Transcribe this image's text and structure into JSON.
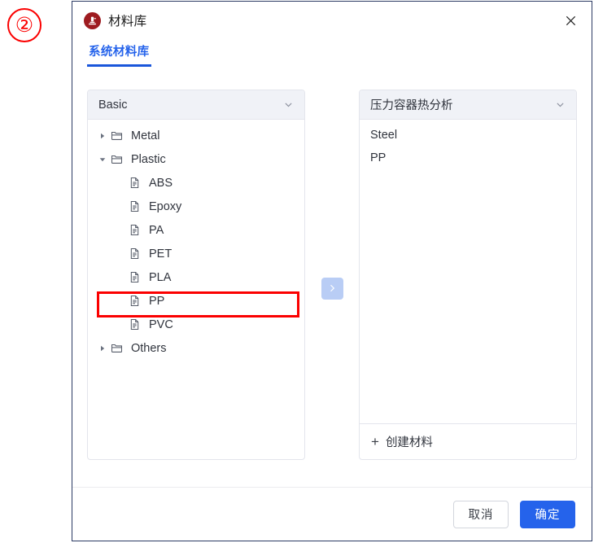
{
  "annotation": {
    "marker_label": "②",
    "marker_color": "#fb0000",
    "highlight_target": "PP"
  },
  "dialog": {
    "title": "材料库",
    "app_icon": "microscope-icon",
    "close_icon": "close-icon",
    "accent_color": "#2563eb"
  },
  "tabs": [
    {
      "label": "系统材料库",
      "active": true
    }
  ],
  "left_panel": {
    "header": {
      "label": "Basic",
      "chevron": "chevron-down-icon"
    },
    "tree": [
      {
        "label": "Metal",
        "type": "folder",
        "depth": 0,
        "expanded": false,
        "caret": "caret-right-icon"
      },
      {
        "label": "Plastic",
        "type": "folder",
        "depth": 0,
        "expanded": true,
        "caret": "caret-down-icon"
      },
      {
        "label": "ABS",
        "type": "document",
        "depth": 1,
        "caret": "none"
      },
      {
        "label": "Epoxy",
        "type": "document",
        "depth": 1,
        "caret": "none"
      },
      {
        "label": "PA",
        "type": "document",
        "depth": 1,
        "caret": "none"
      },
      {
        "label": "PET",
        "type": "document",
        "depth": 1,
        "caret": "none"
      },
      {
        "label": "PLA",
        "type": "document",
        "depth": 1,
        "caret": "none"
      },
      {
        "label": "PP",
        "type": "document",
        "depth": 1,
        "caret": "none",
        "highlighted": true
      },
      {
        "label": "PVC",
        "type": "document",
        "depth": 1,
        "caret": "none"
      },
      {
        "label": "Others",
        "type": "folder",
        "depth": 0,
        "expanded": false,
        "caret": "caret-right-icon"
      }
    ]
  },
  "transfer": {
    "icon": "chevron-right-icon",
    "color": "#b9cdf5"
  },
  "right_panel": {
    "header": {
      "label": "压力容器热分析",
      "chevron": "chevron-down-icon"
    },
    "materials": [
      {
        "label": "Steel"
      },
      {
        "label": "PP"
      }
    ],
    "footer": {
      "plus": "+",
      "label": "创建材料"
    }
  },
  "footer": {
    "cancel_label": "取消",
    "confirm_label": "确定"
  }
}
